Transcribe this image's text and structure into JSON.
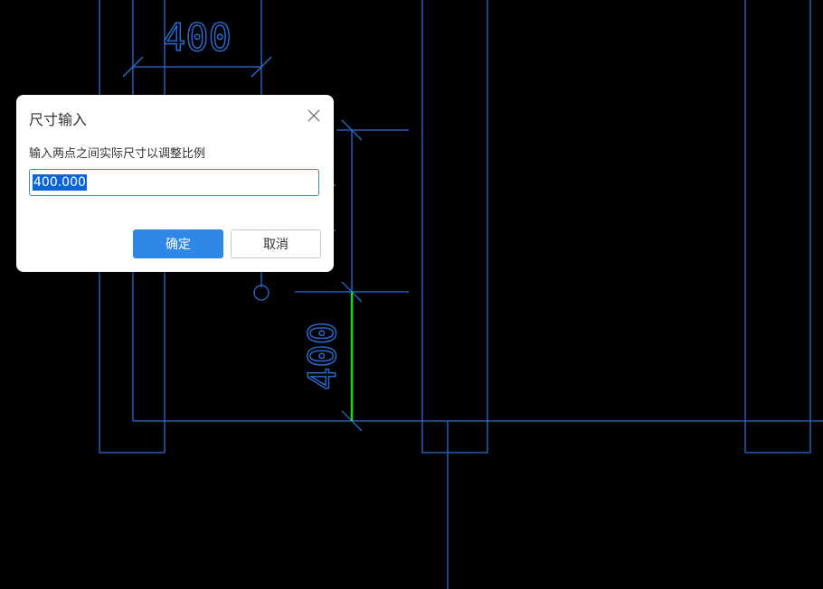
{
  "canvas": {
    "dim_top_label": "400",
    "dim_side_label": "400",
    "colors": {
      "background": "#000000",
      "lines": "#2a6fd6",
      "highlight": "#22d31c"
    }
  },
  "dialog": {
    "title": "尺寸输入",
    "prompt": "输入两点之间实际尺寸以调整比例",
    "input_value": "400.000",
    "ok_label": "确定",
    "cancel_label": "取消",
    "close_icon": "close-icon",
    "colors": {
      "primary": "#2f88e6",
      "input_border": "#3b86e0"
    }
  }
}
